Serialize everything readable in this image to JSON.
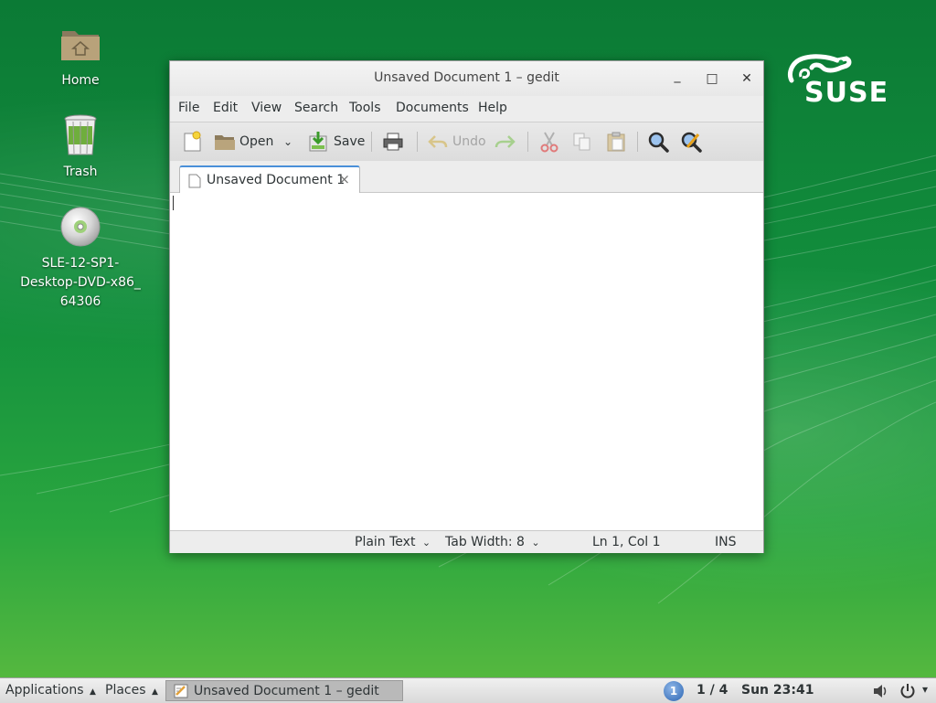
{
  "desktop": {
    "icons": [
      {
        "label": "Home"
      },
      {
        "label": "Trash"
      },
      {
        "label": "SLE-12-SP1-\nDesktop-DVD-x86_\n64306"
      }
    ],
    "logo_text": "SUSE"
  },
  "window": {
    "title": "Unsaved Document 1 – gedit",
    "controls": {
      "minimize": "_",
      "maximize": "□",
      "close": "✕"
    },
    "menu": [
      "File",
      "Edit",
      "View",
      "Search",
      "Tools",
      "Documents",
      "Help"
    ],
    "toolbar": {
      "open_label": "Open",
      "save_label": "Save",
      "undo_label": "Undo"
    },
    "tab": {
      "label": "Unsaved Document 1",
      "close": "×"
    },
    "editor_text": "",
    "status": {
      "language": "Plain Text",
      "tab_width": "Tab Width: 8",
      "position": "Ln 1, Col 1",
      "mode": "INS"
    }
  },
  "panel": {
    "applications": "Applications",
    "places": "Places",
    "task_label": "Unsaved Document 1 – gedit",
    "workspace_badge": "1",
    "workspace": "1 / 4",
    "clock": "Sun 23:41"
  },
  "colors": {
    "background_top": "#0b7a35",
    "background_bottom": "#5cbb3f",
    "focus_accent": "#4a90d9"
  }
}
